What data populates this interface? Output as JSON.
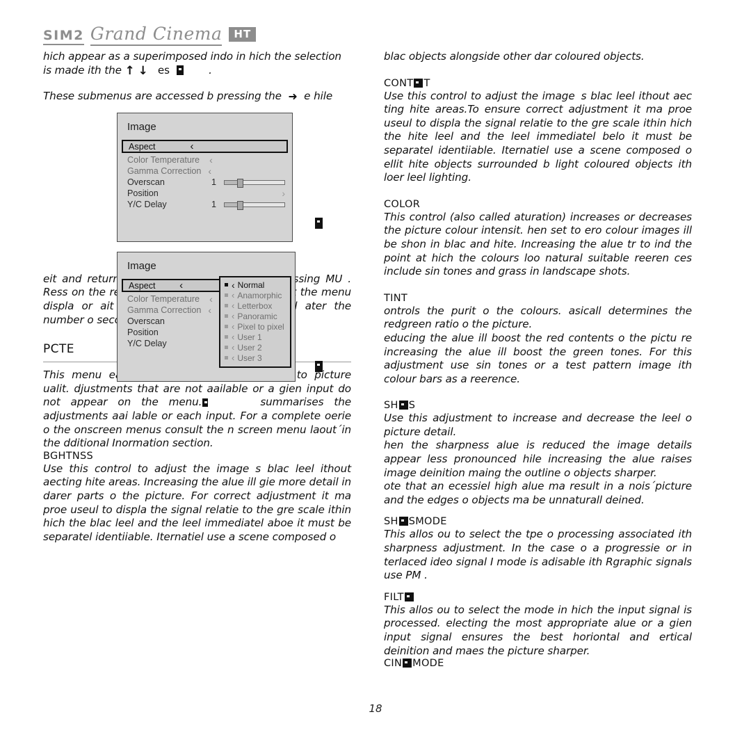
{
  "masthead": {
    "brand": "SIM2",
    "product": "Grand Cinema",
    "badge": "HT"
  },
  "page_number": "18",
  "left_column": {
    "intro_para": "hich appear as a superimposed indo in hich the selection is made ith the",
    "intro_keys_label": "es",
    "intro_trailing": ".",
    "submenu_para_before": "These submenus are accessed b pressing the",
    "submenu_para_after": "e hile",
    "exit_para": "eit and return to the upper leel occurs b pressing    MU        . Ress           on the remote control or epad to interrupt the menu displa or ait or it to disappear automaticall ater the number o seconds set on the  TUP    page.",
    "picture_heading": "PCTE",
    "picture_para_a": "This menu eatures the adjustments related to picture ualit. djustments that are not aailable or a gien input do not appear on the menu.",
    "picture_para_b": "summarises the adjustments aai lable or each input. For a complete oerie o the onscreen menus consult the n screen menu laout´in the dditional Inormation section.",
    "brightness_heading": "BGHTNSS",
    "brightness_para": "Use this control to adjust the images blac leel ithout aecting hite areas. Increasing the alue ill gie more detail in darer parts o the picture. For correct adjustment it ma proe useul to displa the signal relatie to the gre scale ithin hich the blac leel and the leel immediatel aboe it must be separatel identiiable. Iternatiel use a scene composed o"
  },
  "right_column": {
    "continuation_para": "blac objects alongside other dar coloured objects.",
    "sections": [
      {
        "heading_pre": "CONT",
        "heading_post": "T",
        "heading_full": "CONTRAST",
        "body": "Use this control to adjust the images blac leel ithout aec ting hite areas.To ensure correct adjustment it ma proe useul to displa the signal relatie to the gre scale ithin hich the hite leel and the leel immediatel belo it must be separatel identiiable. Iternatiel use a scene composed o ellit hite objects surrounded b light coloured objects ith loer leel lighting."
      },
      {
        "heading_pre": "COLOR",
        "heading_post": "",
        "heading_full": "COLOR",
        "body": "This control (also called aturation) increases or decreases the picture colour intensit. hen set to ero colour images ill be shon in blac and hite. Increasing the alue tr to ind the point at hich the colours loo natural suitable reeren ces include sin tones and grass in landscape shots."
      },
      {
        "heading_pre": "TINT",
        "heading_post": "",
        "heading_full": "TINT",
        "body": "ontrols the purit o the colours. asicall determines the redgreen ratio o the picture.\neducing the alue ill boost the red contents o the pictu re increasing the alue ill boost the green tones. For this adjustment use sin tones or a test pattern image ith colour bars as a reerence."
      },
      {
        "heading_pre": "SH",
        "heading_post": "S",
        "heading_full": "SHARPNESS",
        "body": "Use this adjustment to increase and decrease the leel o picture detail.\nhen the sharpness alue is reduced the image details appear less pronounced hile increasing the alue raises image deinition maing the outline o objects sharper.\note that an ecessiel high alue ma result in a nois´picture and the edges o objects ma be unnaturall deined."
      },
      {
        "heading_pre": "SH",
        "heading_post": "SMODE",
        "heading_full": "SHARPNESS MODE",
        "body": "This allos ou to select the tpe o processing associated ith sharpness adjustment. In the case o a progressie or in terlaced ideo signal  I          mode is adisable ith Rgraphic signals use PM                  ."
      },
      {
        "heading_pre": "FILT",
        "heading_post": "",
        "heading_full": "FILTER",
        "body": "This allos ou to select the mode in hich the input signal is processed. electing the most appropriate alue or a gien input signal ensures the best horiontal and ertical deinition and maes the picture sharper."
      },
      {
        "heading_pre": "CIN",
        "heading_post": "MODE",
        "heading_full": "CINEMA MODE",
        "body": ""
      }
    ]
  },
  "osd_menu_1": {
    "title": "Image",
    "rows": [
      {
        "label": "Aspect",
        "selected": true,
        "left_arrow": true,
        "kind": "arrow"
      },
      {
        "label": "Color Temperature",
        "selected": false,
        "left_arrow": true,
        "kind": "arrow"
      },
      {
        "label": "Gamma Correction",
        "selected": false,
        "left_arrow": true,
        "kind": "arrow"
      },
      {
        "label": "Overscan",
        "selected": false,
        "left_arrow": false,
        "kind": "slider",
        "value": "1"
      },
      {
        "label": "Position",
        "selected": false,
        "left_arrow": false,
        "kind": "right-arrow"
      },
      {
        "label": "Y/C Delay",
        "selected": false,
        "left_arrow": false,
        "kind": "slider",
        "value": "1"
      }
    ]
  },
  "osd_menu_2": {
    "title": "Image",
    "rows": [
      {
        "label": "Aspect",
        "selected": true
      },
      {
        "label": "Color Temperature",
        "selected": false
      },
      {
        "label": "Gamma Correction",
        "selected": false
      },
      {
        "label": "Overscan",
        "selected": false
      },
      {
        "label": "Position",
        "selected": false
      },
      {
        "label": "Y/C Delay",
        "selected": false
      }
    ],
    "popup": {
      "options": [
        {
          "label": "Normal",
          "active": true
        },
        {
          "label": "Anamorphic",
          "active": false
        },
        {
          "label": "Letterbox",
          "active": false
        },
        {
          "label": "Panoramic",
          "active": false
        },
        {
          "label": "Pixel to pixel",
          "active": false
        },
        {
          "label": "User 1",
          "active": false
        },
        {
          "label": "User 2",
          "active": false
        },
        {
          "label": "User 3",
          "active": false
        }
      ]
    }
  },
  "icons": {
    "up_arrow": "↑",
    "down_arrow": "↓",
    "right_arrow": "➔",
    "chevron_left": "‹",
    "chevron_right": "›"
  }
}
